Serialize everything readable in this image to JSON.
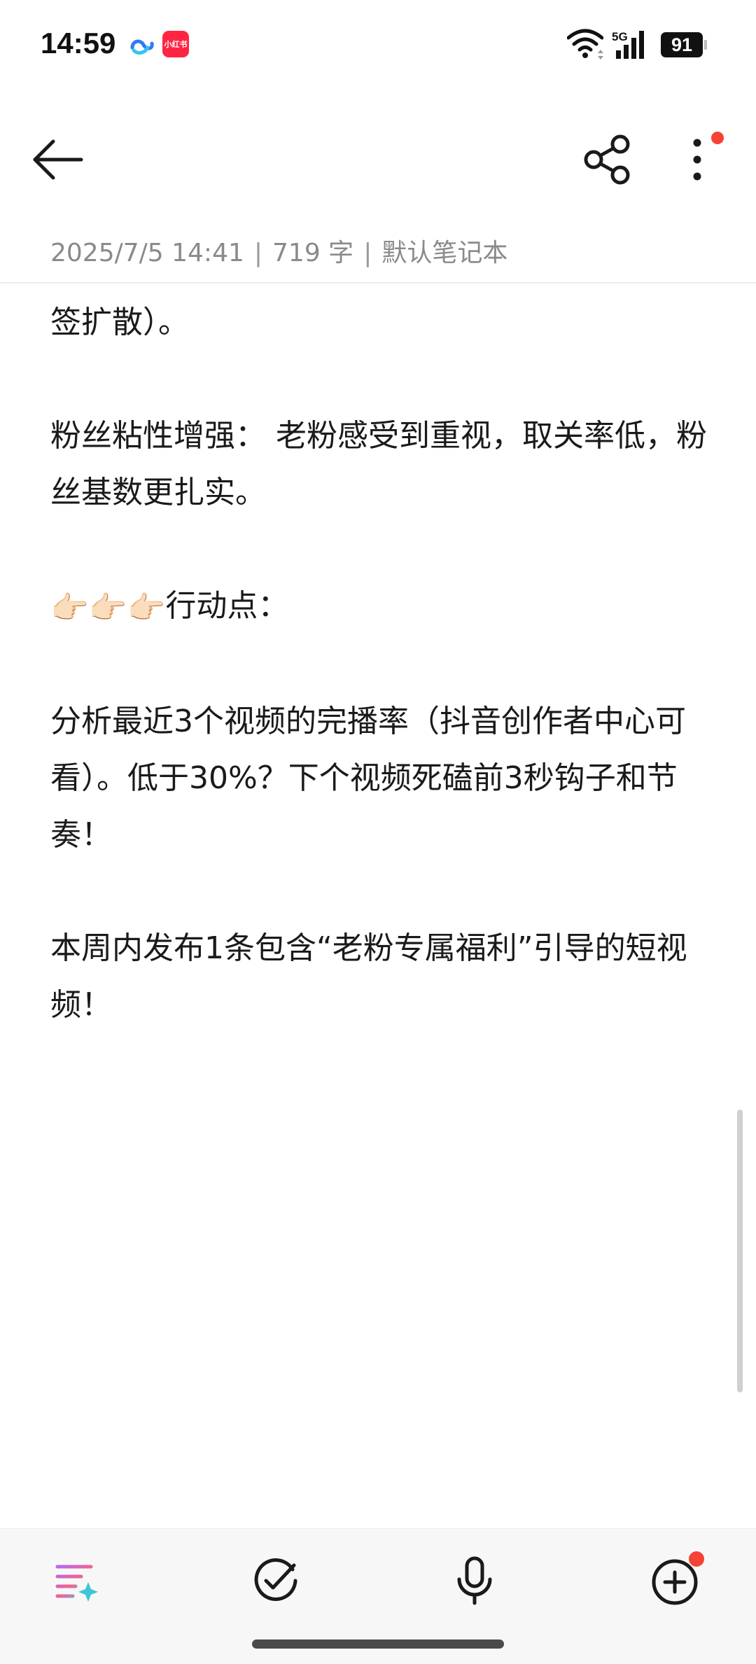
{
  "status_bar": {
    "time": "14:59",
    "app_badge": "小红书",
    "network": "5G",
    "battery": "91"
  },
  "toolbar": {
    "back_icon": "arrow-left-icon",
    "share_icon": "share-icon",
    "more_icon": "more-vertical-icon",
    "notification_color": "#f44336"
  },
  "meta": {
    "datetime": "2025/7/5 14:41",
    "separator": "|",
    "word_count": "719 字",
    "notebook": "默认笔记本"
  },
  "content": {
    "line1": "签扩散）。",
    "para2": "粉丝粘性增强： 老粉感受到重视，取关率低，粉丝基数更扎实。",
    "action_emoji": "👉🏻👉🏻👉🏻",
    "action_label": "行动点：",
    "para4": "分析最近3个视频的完播率（抖音创作者中心可看）。低于30%？下个视频死磕前3秒钩子和节奏！",
    "para5": "本周内发布1条包含“老粉专属福利”引导的短视频！"
  },
  "bottom_bar": {
    "icons": [
      "ai-list-icon",
      "checklist-icon",
      "microphone-icon",
      "add-icon"
    ]
  }
}
